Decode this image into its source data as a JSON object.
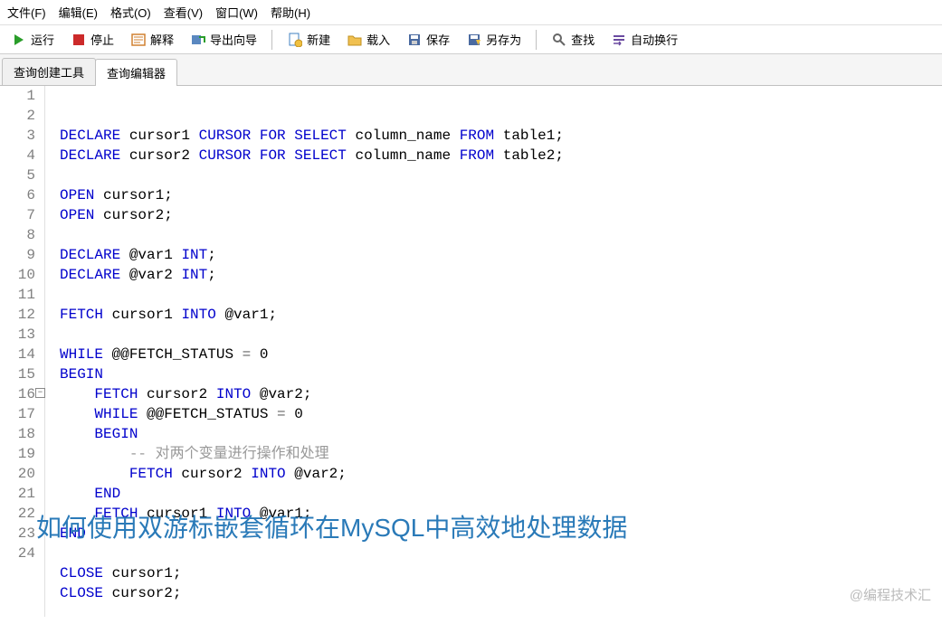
{
  "menu": {
    "file": "文件(F)",
    "edit": "编辑(E)",
    "format": "格式(O)",
    "view": "查看(V)",
    "window": "窗口(W)",
    "help": "帮助(H)"
  },
  "toolbar": {
    "run": "运行",
    "stop": "停止",
    "explain": "解释",
    "export": "导出向导",
    "new": "新建",
    "load": "载入",
    "save": "保存",
    "saveas": "另存为",
    "find": "查找",
    "wrap": "自动换行"
  },
  "tabs": {
    "builder": "查询创建工具",
    "editor": "查询编辑器"
  },
  "code": [
    {
      "n": 1,
      "tokens": [
        [
          "kw",
          "DECLARE"
        ],
        [
          "txt",
          " cursor1 "
        ],
        [
          "kw",
          "CURSOR FOR SELECT"
        ],
        [
          "txt",
          " column_name "
        ],
        [
          "kw",
          "FROM"
        ],
        [
          "txt",
          " table1;"
        ]
      ]
    },
    {
      "n": 2,
      "tokens": [
        [
          "kw",
          "DECLARE"
        ],
        [
          "txt",
          " cursor2 "
        ],
        [
          "kw",
          "CURSOR FOR SELECT"
        ],
        [
          "txt",
          " column_name "
        ],
        [
          "kw",
          "FROM"
        ],
        [
          "txt",
          " table2;"
        ]
      ]
    },
    {
      "n": 3,
      "tokens": []
    },
    {
      "n": 4,
      "tokens": [
        [
          "kw",
          "OPEN"
        ],
        [
          "txt",
          " cursor1;"
        ]
      ]
    },
    {
      "n": 5,
      "tokens": [
        [
          "kw",
          "OPEN"
        ],
        [
          "txt",
          " cursor2;"
        ]
      ]
    },
    {
      "n": 6,
      "tokens": []
    },
    {
      "n": 7,
      "tokens": [
        [
          "kw",
          "DECLARE"
        ],
        [
          "txt",
          " @var1 "
        ],
        [
          "kw",
          "INT"
        ],
        [
          "txt",
          ";"
        ]
      ]
    },
    {
      "n": 8,
      "tokens": [
        [
          "kw",
          "DECLARE"
        ],
        [
          "txt",
          " @var2 "
        ],
        [
          "kw",
          "INT"
        ],
        [
          "txt",
          ";"
        ]
      ]
    },
    {
      "n": 9,
      "tokens": []
    },
    {
      "n": 10,
      "tokens": [
        [
          "kw",
          "FETCH"
        ],
        [
          "txt",
          " cursor1 "
        ],
        [
          "kw",
          "INTO"
        ],
        [
          "txt",
          " @var1;"
        ]
      ]
    },
    {
      "n": 11,
      "tokens": []
    },
    {
      "n": 12,
      "tokens": [
        [
          "kw",
          "WHILE"
        ],
        [
          "txt",
          " @@FETCH_STATUS "
        ],
        [
          "op",
          "="
        ],
        [
          "txt",
          " 0"
        ]
      ]
    },
    {
      "n": 13,
      "tokens": [
        [
          "kw",
          "BEGIN"
        ]
      ]
    },
    {
      "n": 14,
      "tokens": [
        [
          "txt",
          "    "
        ],
        [
          "kw",
          "FETCH"
        ],
        [
          "txt",
          " cursor2 "
        ],
        [
          "kw",
          "INTO"
        ],
        [
          "txt",
          " @var2;"
        ]
      ]
    },
    {
      "n": 15,
      "tokens": [
        [
          "txt",
          "    "
        ],
        [
          "kw",
          "WHILE"
        ],
        [
          "txt",
          " @@FETCH_STATUS "
        ],
        [
          "op",
          "="
        ],
        [
          "txt",
          " 0"
        ]
      ]
    },
    {
      "n": 16,
      "tokens": [
        [
          "txt",
          "    "
        ],
        [
          "kw",
          "BEGIN"
        ]
      ],
      "fold": true
    },
    {
      "n": 17,
      "tokens": [
        [
          "txt",
          "        "
        ],
        [
          "comment",
          "-- 对两个变量进行操作和处理"
        ]
      ]
    },
    {
      "n": 18,
      "tokens": [
        [
          "txt",
          "        "
        ],
        [
          "kw",
          "FETCH"
        ],
        [
          "txt",
          " cursor2 "
        ],
        [
          "kw",
          "INTO"
        ],
        [
          "txt",
          " @var2;"
        ]
      ]
    },
    {
      "n": 19,
      "tokens": [
        [
          "txt",
          "    "
        ],
        [
          "kw",
          "END"
        ]
      ]
    },
    {
      "n": 20,
      "tokens": [
        [
          "txt",
          "    "
        ],
        [
          "kw",
          "FETCH"
        ],
        [
          "txt",
          " cursor1 "
        ],
        [
          "kw",
          "INTO"
        ],
        [
          "txt",
          " @var1;"
        ]
      ]
    },
    {
      "n": 21,
      "tokens": [
        [
          "kw",
          "END"
        ]
      ]
    },
    {
      "n": 22,
      "tokens": []
    },
    {
      "n": 23,
      "tokens": [
        [
          "kw",
          "CLOSE"
        ],
        [
          "txt",
          " cursor1;"
        ]
      ]
    },
    {
      "n": 24,
      "tokens": [
        [
          "kw",
          "CLOSE"
        ],
        [
          "txt",
          " cursor2;"
        ]
      ]
    }
  ],
  "overlay": "如何使用双游标嵌套循环在MySQL中高效地处理数据",
  "watermark": "​@编程技术汇"
}
